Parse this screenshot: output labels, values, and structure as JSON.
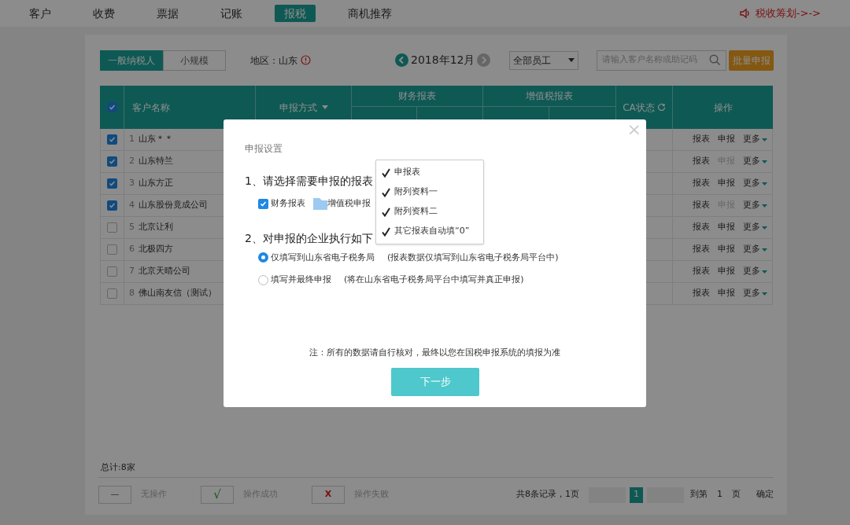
{
  "nav": {
    "tabs": [
      {
        "label": "客户",
        "selected": false
      },
      {
        "label": "收费",
        "selected": false
      },
      {
        "label": "票据",
        "selected": false
      },
      {
        "label": "记账",
        "selected": false
      },
      {
        "label": "报税",
        "selected": true
      },
      {
        "label": "商机推荐",
        "selected": false
      }
    ],
    "promo": "税收筹划->->"
  },
  "toolbar": {
    "taxpayer_tabs": [
      {
        "label": "一般纳税人",
        "selected": true
      },
      {
        "label": "小规模",
        "selected": false
      }
    ],
    "region_label": "地区：山东",
    "period": "2018年12月",
    "staff_select": "全部员工",
    "search": {
      "placeholder": "请输入客户名称或助记码"
    },
    "batch_button": "批量申报"
  },
  "table": {
    "header": {
      "checked": true,
      "name": "客户名称",
      "method": "申报方式",
      "finance": "财务报表",
      "vat": "增值税报表",
      "ca": "CA状态",
      "ops": "操作"
    },
    "rows": [
      {
        "checked": true,
        "index": "1",
        "name": "山东＊＊",
        "report": "报表",
        "declare": "申报",
        "declare_disabled": false,
        "more": "更多"
      },
      {
        "checked": true,
        "index": "2",
        "name": "山东特兰",
        "report": "报表",
        "declare": "申报",
        "declare_disabled": true,
        "more": "更多"
      },
      {
        "checked": true,
        "index": "3",
        "name": "山东方正",
        "report": "报表",
        "declare": "申报",
        "declare_disabled": false,
        "more": "更多"
      },
      {
        "checked": true,
        "index": "4",
        "name": "山东股份竟成公司",
        "report": "报表",
        "declare": "申报",
        "declare_disabled": true,
        "more": "更多"
      },
      {
        "checked": false,
        "index": "5",
        "name": "北京让利",
        "report": "报表",
        "declare": "申报",
        "declare_disabled": false,
        "more": "更多"
      },
      {
        "checked": false,
        "index": "6",
        "name": "北极四方",
        "report": "报表",
        "declare": "申报",
        "declare_disabled": false,
        "more": "更多"
      },
      {
        "checked": false,
        "index": "7",
        "name": "北京天晴公司",
        "report": "报表",
        "declare": "申报",
        "declare_disabled": false,
        "more": "更多"
      },
      {
        "checked": false,
        "index": "8",
        "name": "佛山南友信（测试）",
        "report": "报表",
        "declare": "申报",
        "declare_disabled": false,
        "more": "更多"
      }
    ]
  },
  "footer": {
    "total": "总计:8家",
    "legend": [
      {
        "kind": "none",
        "symbol": "—",
        "label": "无操作"
      },
      {
        "kind": "success",
        "symbol": "√",
        "label": "操作成功"
      },
      {
        "kind": "fail",
        "symbol": "X",
        "label": "操作失败"
      }
    ],
    "pagination": {
      "summary": "共8条记录，1页",
      "page": "1",
      "goto": "到第",
      "page_input": "1",
      "unit": "页",
      "confirm": "确定"
    }
  },
  "modal": {
    "title": "申报设置",
    "close": "×",
    "step1": "1、请选择需要申报的报表",
    "options": [
      {
        "kind": "checkbox",
        "label": "财务报表",
        "checked": true
      },
      {
        "kind": "dropdown",
        "label": "增值税申报"
      }
    ],
    "menu": [
      {
        "label": "申报表",
        "checked": true
      },
      {
        "label": "附列资料一",
        "checked": true
      },
      {
        "label": "附列资料二",
        "checked": true
      },
      {
        "label": "其它报表自动填“0”",
        "checked": true
      }
    ],
    "step2": "2、对申报的企业执行如下",
    "radios": [
      {
        "label": "仅填写到山东省电子税务局",
        "note": "(报表数据仅填写到山东省电子税务局平台中)",
        "selected": true
      },
      {
        "label": "填写并最终申报",
        "note": "(将在山东省电子税务局平台中填写并真正申报)",
        "selected": false
      }
    ],
    "note": "注：所有的数据请自行核对，最终以您在国税申报系统的填报为准",
    "button": "下一步"
  }
}
